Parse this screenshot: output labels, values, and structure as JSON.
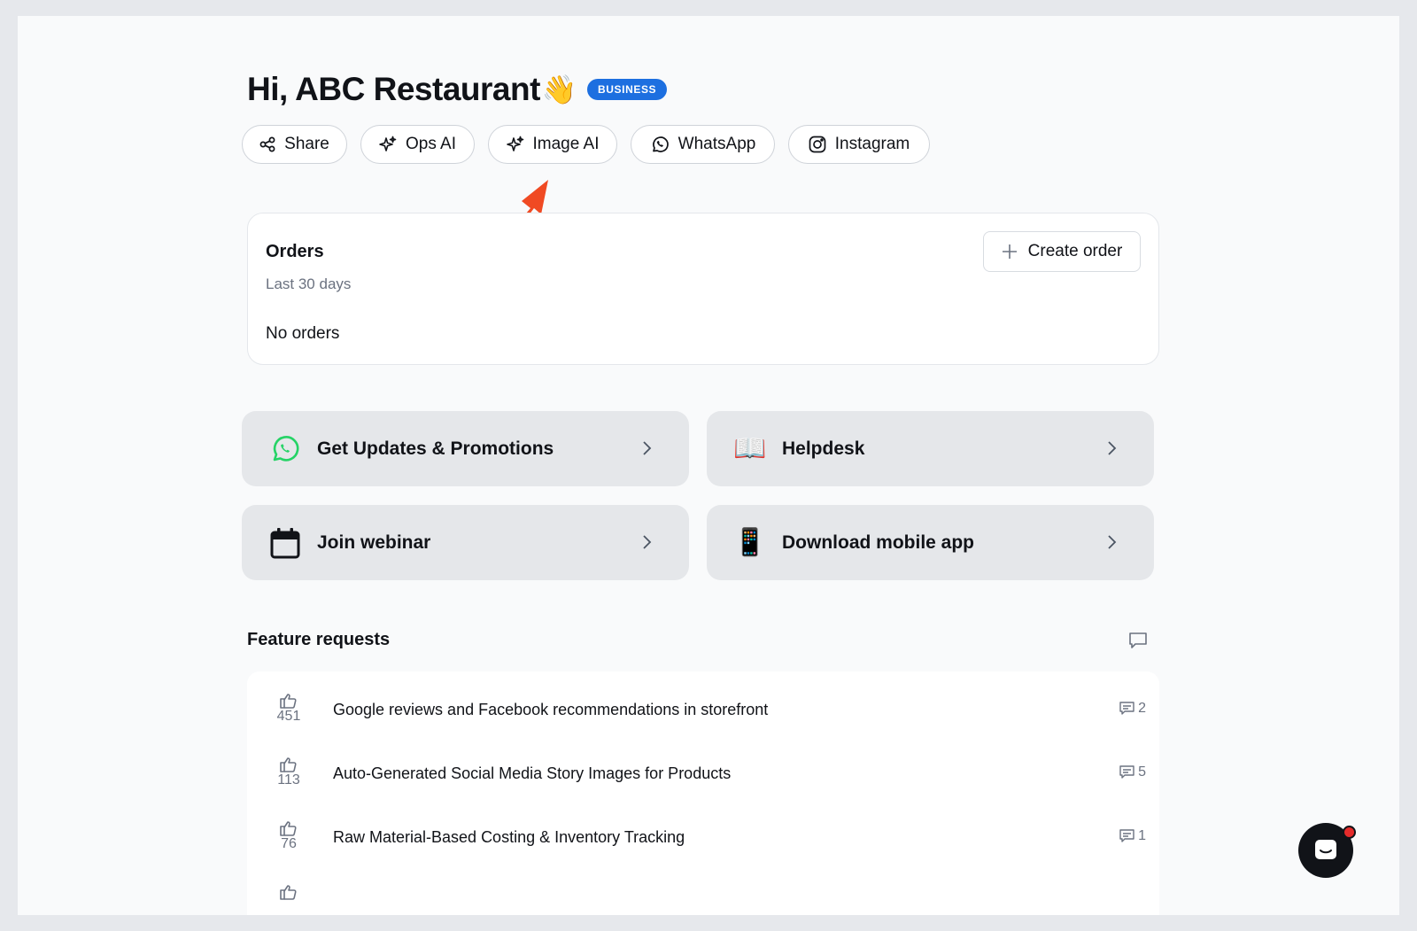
{
  "header": {
    "greeting": "Hi, ABC Restaurant",
    "wave_emoji": "👋",
    "badge": "BUSINESS"
  },
  "actions": [
    {
      "label": "Share",
      "icon": "share-icon"
    },
    {
      "label": "Ops AI",
      "icon": "sparkles-icon"
    },
    {
      "label": "Image AI",
      "icon": "sparkles-icon"
    },
    {
      "label": "WhatsApp",
      "icon": "whatsapp-icon"
    },
    {
      "label": "Instagram",
      "icon": "instagram-icon"
    }
  ],
  "orders": {
    "title": "Orders",
    "subtitle": "Last 30 days",
    "empty_text": "No orders",
    "create_label": "Create order"
  },
  "tiles": [
    {
      "label": "Get Updates & Promotions",
      "icon": "whatsapp-icon"
    },
    {
      "label": "Helpdesk",
      "icon": "book-icon",
      "emoji": "📖"
    },
    {
      "label": "Join webinar",
      "icon": "calendar-icon"
    },
    {
      "label": "Download mobile app",
      "icon": "phone-icon",
      "emoji": "📱"
    }
  ],
  "feature_requests": {
    "title": "Feature requests",
    "items": [
      {
        "votes": "451",
        "text": "Google reviews and Facebook recommendations in storefront",
        "comments": "2"
      },
      {
        "votes": "113",
        "text": "Auto-Generated Social Media Story Images for Products",
        "comments": "5"
      },
      {
        "votes": "76",
        "text": "Raw Material-Based Costing & Inventory Tracking",
        "comments": "1"
      }
    ]
  },
  "colors": {
    "badge": "#1d6fe0",
    "annotation_arrow": "#f04a23",
    "whatsapp": "#25d366",
    "page_bg": "#f9fafb"
  }
}
